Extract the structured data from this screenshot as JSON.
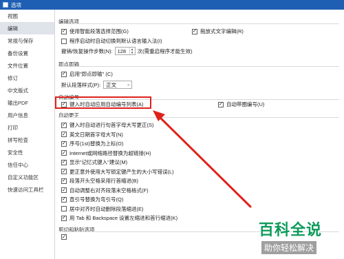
{
  "window": {
    "title": "选项"
  },
  "sidebar": {
    "items": [
      {
        "label": "视图",
        "active": false
      },
      {
        "label": "编辑",
        "active": true
      },
      {
        "label": "常规与保存",
        "active": false
      },
      {
        "label": "备份设置",
        "active": false
      },
      {
        "label": "文件位置",
        "active": false
      },
      {
        "label": "修订",
        "active": false
      },
      {
        "label": "中文版式",
        "active": false
      },
      {
        "label": "输出PDF",
        "active": false
      },
      {
        "label": "用户信息",
        "active": false
      },
      {
        "label": "打印",
        "active": false
      },
      {
        "label": "拼写检查",
        "active": false
      },
      {
        "label": "安全性",
        "active": false
      },
      {
        "label": "信任中心",
        "active": false
      },
      {
        "label": "自定义功能区",
        "active": false
      },
      {
        "label": "快速访问工具栏",
        "active": false
      }
    ]
  },
  "edit_options": {
    "title": "编辑选项",
    "smart_select": {
      "label": "使用智能段落选择范围(G)",
      "checked": true
    },
    "drag_text": {
      "label": "拖放式文字编辑(R)",
      "checked": true
    },
    "auto_ime": {
      "label": "程序启动时自动切换到默认语言输入法(I)",
      "checked": false
    },
    "undo_steps_label": "撤销/恢复操作步数(N):",
    "undo_steps_value": "128",
    "undo_steps_note": "次(需重启程序才能生效)"
  },
  "click_and_type": {
    "title": "即点即输",
    "enable": {
      "label": "启用\"即点即输\" (C)",
      "checked": true
    },
    "default_style_label": "默认段落样式(P):",
    "default_style_value": "正文"
  },
  "auto_numbering": {
    "title": "自动编号",
    "numbered_list": {
      "label": "键入时自动应用自动编号列表(A)",
      "checked": true
    },
    "auto_bullets": {
      "label": "自动带圈编号(U)",
      "checked": true
    }
  },
  "autocorrect": {
    "title": "自动更正",
    "items": [
      {
        "label": "键入时自动进行句首字母大写更正(S)",
        "checked": true
      },
      {
        "label": "英文日期首字母大写(N)",
        "checked": true
      },
      {
        "label": "序号(1st)替换为上标(O)",
        "checked": true
      },
      {
        "label": "Internet或网络路径替换为超链接(H)",
        "checked": true
      },
      {
        "label": "显示\"记忆式键入\"建议(M)",
        "checked": true
      },
      {
        "label": "更正意外使用大写锁定键产生的大小写错误(L)",
        "checked": true
      },
      {
        "label": "段落开头空格采用行首缩进(B)",
        "checked": true
      },
      {
        "label": "自动调整右对齐段落末空格格式(F)",
        "checked": true
      },
      {
        "label": "直引号替换为弯引号(Q)",
        "checked": true
      },
      {
        "label": "居中对齐时自动删除段落缩进(E)",
        "checked": false
      },
      {
        "label": "用 Tab 和 Backspace 设置左缩进和首行缩进(K)",
        "checked": true
      }
    ]
  },
  "clipboard": {
    "title": "剪切和粘贴选项"
  },
  "watermark": {
    "brand": "百科全说",
    "slogan": "助你轻松解决"
  }
}
